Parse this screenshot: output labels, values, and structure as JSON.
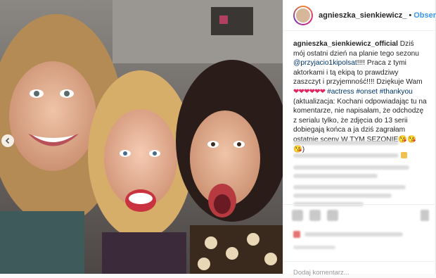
{
  "post": {
    "header": {
      "username": "agnieszka_sienkiewicz_",
      "separator": "•",
      "follow_label": "Obserwu"
    },
    "caption": {
      "author": "agnieszka_sienkiewicz_official",
      "text_1": "Dziś mój ostatni dzień na planie tego sezonu",
      "mention": "@przyjacio1kipolsat",
      "text_2": "!!!! Praca z tymi aktorkami i tą ekipą to prawdziwy zaszczyt i przyjemność!!!! Dziękuje Wam",
      "hearts": "❤❤❤❤❤❤",
      "hashtags": "#actress #onset #thankyou",
      "text_3": "(aktualizacja: Kochani odpowiadając tu na komentarze, nie napisałam, że odchodzę z serialu tylko, że zdjęcia do 13 serii dobiegają końca a ja dziś zagrałam ostatnie sceny W TYM SEZONIE",
      "emojis": "😘😘😘",
      "text_4": ")"
    },
    "comment_input": {
      "placeholder": "Dodaj komentarz..."
    },
    "icons": {
      "prev": "chevron-left-icon",
      "like": "heart-icon",
      "comment": "comment-icon",
      "share": "share-icon",
      "save": "bookmark-icon"
    },
    "colors": {
      "link": "#003569",
      "follow": "#3897f0",
      "heart": "#e0245e"
    }
  }
}
